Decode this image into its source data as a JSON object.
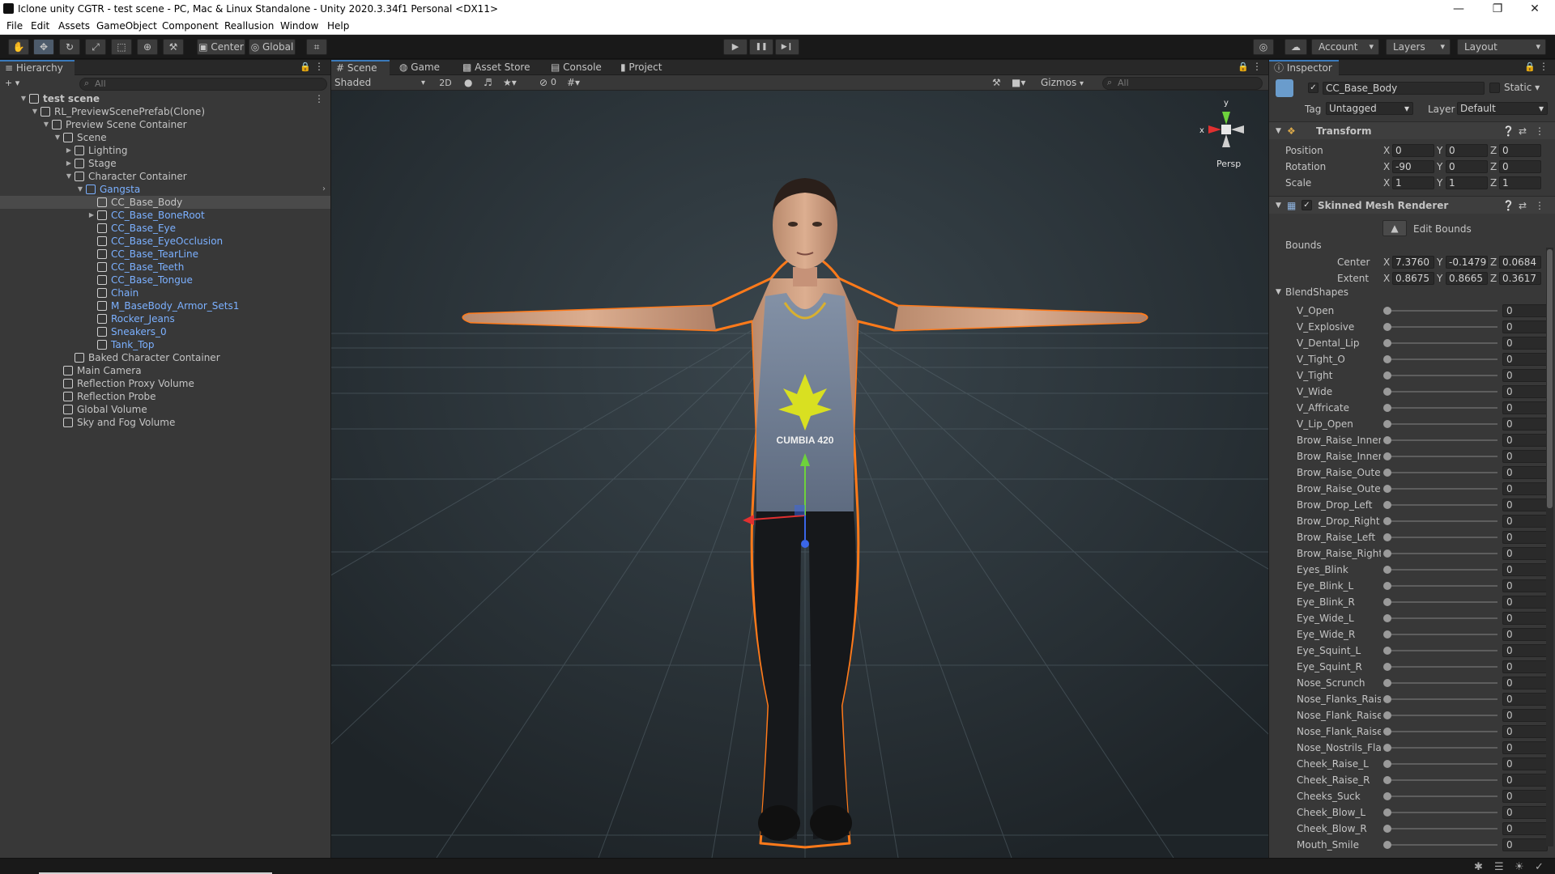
{
  "window": {
    "title": "Iclone unity CGTR - test scene - PC, Mac & Linux Standalone - Unity 2020.3.34f1 Personal <DX11>",
    "minimize_glyph": "—",
    "maximize_glyph": "❐",
    "close_glyph": "✕"
  },
  "menu": [
    "File",
    "Edit",
    "Assets",
    "GameObject",
    "Component",
    "Reallusion",
    "Window",
    "Help"
  ],
  "toolbar": {
    "tools": [
      {
        "name": "hand-tool-icon",
        "glyph": "✋"
      },
      {
        "name": "move-tool-icon",
        "glyph": "✥"
      },
      {
        "name": "rotate-tool-icon",
        "glyph": "↻"
      },
      {
        "name": "scale-tool-icon",
        "glyph": "⤢"
      },
      {
        "name": "rect-tool-icon",
        "glyph": "⬚"
      },
      {
        "name": "transform-tool-icon",
        "glyph": "⊕"
      },
      {
        "name": "custom-tool-icon",
        "glyph": "⚒"
      }
    ],
    "pivot_label": "Center",
    "space_label": "Global",
    "snap_glyph": "⌗",
    "play_glyph": "▶",
    "pause_glyph": "❚❚",
    "step_glyph": "▶❙",
    "collab_glyph": "◎",
    "cloud_glyph": "☁",
    "account_label": "Account",
    "layers_label": "Layers",
    "layout_label": "Layout"
  },
  "hierarchy": {
    "tab_label": "Hierarchy",
    "add_label": "+ ▾",
    "search_placeholder": "All",
    "rows": [
      {
        "label": "test scene",
        "depth": 0,
        "arrow": "open",
        "kind": "scene",
        "blue": false,
        "selected": false,
        "bold": true
      },
      {
        "label": "RL_PreviewScenePrefab(Clone)",
        "depth": 1,
        "arrow": "open",
        "kind": "object",
        "blue": false,
        "selected": false
      },
      {
        "label": "Preview Scene Container",
        "depth": 2,
        "arrow": "open",
        "kind": "object",
        "blue": false,
        "selected": false
      },
      {
        "label": "Scene",
        "depth": 3,
        "arrow": "open",
        "kind": "object",
        "blue": false,
        "selected": false
      },
      {
        "label": "Lighting",
        "depth": 4,
        "arrow": "closed",
        "kind": "object",
        "blue": false,
        "selected": false
      },
      {
        "label": "Stage",
        "depth": 4,
        "arrow": "closed",
        "kind": "object",
        "blue": false,
        "selected": false
      },
      {
        "label": "Character Container",
        "depth": 4,
        "arrow": "open",
        "kind": "object",
        "blue": false,
        "selected": false
      },
      {
        "label": "Gangsta",
        "depth": 5,
        "arrow": "open",
        "kind": "prefab",
        "blue": true,
        "selected": false
      },
      {
        "label": "CC_Base_Body",
        "depth": 6,
        "arrow": "none",
        "kind": "object",
        "blue": false,
        "selected": true
      },
      {
        "label": "CC_Base_BoneRoot",
        "depth": 6,
        "arrow": "closed",
        "kind": "object",
        "blue": true,
        "selected": false
      },
      {
        "label": "CC_Base_Eye",
        "depth": 6,
        "arrow": "none",
        "kind": "object",
        "blue": true,
        "selected": false
      },
      {
        "label": "CC_Base_EyeOcclusion",
        "depth": 6,
        "arrow": "none",
        "kind": "object",
        "blue": true,
        "selected": false
      },
      {
        "label": "CC_Base_TearLine",
        "depth": 6,
        "arrow": "none",
        "kind": "object",
        "blue": true,
        "selected": false
      },
      {
        "label": "CC_Base_Teeth",
        "depth": 6,
        "arrow": "none",
        "kind": "object",
        "blue": true,
        "selected": false
      },
      {
        "label": "CC_Base_Tongue",
        "depth": 6,
        "arrow": "none",
        "kind": "object",
        "blue": true,
        "selected": false
      },
      {
        "label": "Chain",
        "depth": 6,
        "arrow": "none",
        "kind": "object",
        "blue": true,
        "selected": false
      },
      {
        "label": "M_BaseBody_Armor_Sets1",
        "depth": 6,
        "arrow": "none",
        "kind": "object",
        "blue": true,
        "selected": false
      },
      {
        "label": "Rocker_Jeans",
        "depth": 6,
        "arrow": "none",
        "kind": "object",
        "blue": true,
        "selected": false
      },
      {
        "label": "Sneakers_0",
        "depth": 6,
        "arrow": "none",
        "kind": "object",
        "blue": true,
        "selected": false
      },
      {
        "label": "Tank_Top",
        "depth": 6,
        "arrow": "none",
        "kind": "object",
        "blue": true,
        "selected": false
      },
      {
        "label": "Baked Character Container",
        "depth": 4,
        "arrow": "none",
        "kind": "object",
        "blue": false,
        "selected": false
      },
      {
        "label": "Main Camera",
        "depth": 3,
        "arrow": "none",
        "kind": "object",
        "blue": false,
        "selected": false
      },
      {
        "label": "Reflection Proxy Volume",
        "depth": 3,
        "arrow": "none",
        "kind": "object",
        "blue": false,
        "selected": false
      },
      {
        "label": "Reflection Probe",
        "depth": 3,
        "arrow": "none",
        "kind": "object",
        "blue": false,
        "selected": false
      },
      {
        "label": "Global Volume",
        "depth": 3,
        "arrow": "none",
        "kind": "object",
        "blue": false,
        "selected": false
      },
      {
        "label": "Sky and Fog Volume",
        "depth": 3,
        "arrow": "none",
        "kind": "object",
        "blue": false,
        "selected": false
      }
    ]
  },
  "scene_tabs": [
    {
      "label": "Scene",
      "active": true,
      "icon": "hash-icon"
    },
    {
      "label": "Game",
      "active": false,
      "icon": "gamepad-icon"
    },
    {
      "label": "Asset Store",
      "active": false,
      "icon": "bag-icon"
    },
    {
      "label": "Console",
      "active": false,
      "icon": "console-icon"
    },
    {
      "label": "Project",
      "active": false,
      "icon": "folder-icon"
    }
  ],
  "scene_toolbar": {
    "shading_mode": "Shaded",
    "mode_2d": "2D",
    "hidden_count": "0",
    "gizmos_label": "Gizmos",
    "search_placeholder": "All"
  },
  "scene_view": {
    "persp_label": "Persp",
    "axis_x": "x",
    "axis_y": "y",
    "shirt_text": "CUMBIA 420"
  },
  "inspector": {
    "tab_label": "Inspector",
    "object_name": "CC_Base_Body",
    "static_label": "Static",
    "tag_label": "Tag",
    "tag_value": "Untagged",
    "layer_label": "Layer",
    "layer_value": "Default",
    "transform": {
      "header": "Transform",
      "rows": [
        {
          "label": "Position",
          "x": "0",
          "y": "0",
          "z": "0"
        },
        {
          "label": "Rotation",
          "x": "-90",
          "y": "0",
          "z": "0"
        },
        {
          "label": "Scale",
          "x": "1",
          "y": "1",
          "z": "1"
        }
      ]
    },
    "skinned_mesh": {
      "header": "Skinned Mesh Renderer",
      "edit_bounds": "Edit Bounds",
      "bounds_label": "Bounds",
      "center": {
        "label": "Center",
        "x": "7.3760",
        "y": "-0.1479",
        "z": "0.0684"
      },
      "extent": {
        "label": "Extent",
        "x": "0.8675",
        "y": "0.8665",
        "z": "0.3617"
      }
    },
    "blendshapes_label": "BlendShapes",
    "blendshapes": [
      {
        "name": "V_Open",
        "value": "0"
      },
      {
        "name": "V_Explosive",
        "value": "0"
      },
      {
        "name": "V_Dental_Lip",
        "value": "0"
      },
      {
        "name": "V_Tight_O",
        "value": "0"
      },
      {
        "name": "V_Tight",
        "value": "0"
      },
      {
        "name": "V_Wide",
        "value": "0"
      },
      {
        "name": "V_Affricate",
        "value": "0"
      },
      {
        "name": "V_Lip_Open",
        "value": "0"
      },
      {
        "name": "Brow_Raise_Inner_",
        "value": "0"
      },
      {
        "name": "Brow_Raise_Inner_",
        "value": "0"
      },
      {
        "name": "Brow_Raise_Outer_",
        "value": "0"
      },
      {
        "name": "Brow_Raise_Outer_",
        "value": "0"
      },
      {
        "name": "Brow_Drop_Left",
        "value": "0"
      },
      {
        "name": "Brow_Drop_Right",
        "value": "0"
      },
      {
        "name": "Brow_Raise_Left",
        "value": "0"
      },
      {
        "name": "Brow_Raise_Right",
        "value": "0"
      },
      {
        "name": "Eyes_Blink",
        "value": "0"
      },
      {
        "name": "Eye_Blink_L",
        "value": "0"
      },
      {
        "name": "Eye_Blink_R",
        "value": "0"
      },
      {
        "name": "Eye_Wide_L",
        "value": "0"
      },
      {
        "name": "Eye_Wide_R",
        "value": "0"
      },
      {
        "name": "Eye_Squint_L",
        "value": "0"
      },
      {
        "name": "Eye_Squint_R",
        "value": "0"
      },
      {
        "name": "Nose_Scrunch",
        "value": "0"
      },
      {
        "name": "Nose_Flanks_Raise",
        "value": "0"
      },
      {
        "name": "Nose_Flank_Raise_",
        "value": "0"
      },
      {
        "name": "Nose_Flank_Raise_",
        "value": "0"
      },
      {
        "name": "Nose_Nostrils_Flar",
        "value": "0"
      },
      {
        "name": "Cheek_Raise_L",
        "value": "0"
      },
      {
        "name": "Cheek_Raise_R",
        "value": "0"
      },
      {
        "name": "Cheeks_Suck",
        "value": "0"
      },
      {
        "name": "Cheek_Blow_L",
        "value": "0"
      },
      {
        "name": "Cheek_Blow_R",
        "value": "0"
      },
      {
        "name": "Mouth_Smile",
        "value": "0"
      }
    ]
  },
  "colors": {
    "selection_outline": "#ff7a1a",
    "accent": "#3a79bb",
    "prefab_text": "#7bb0ff"
  }
}
